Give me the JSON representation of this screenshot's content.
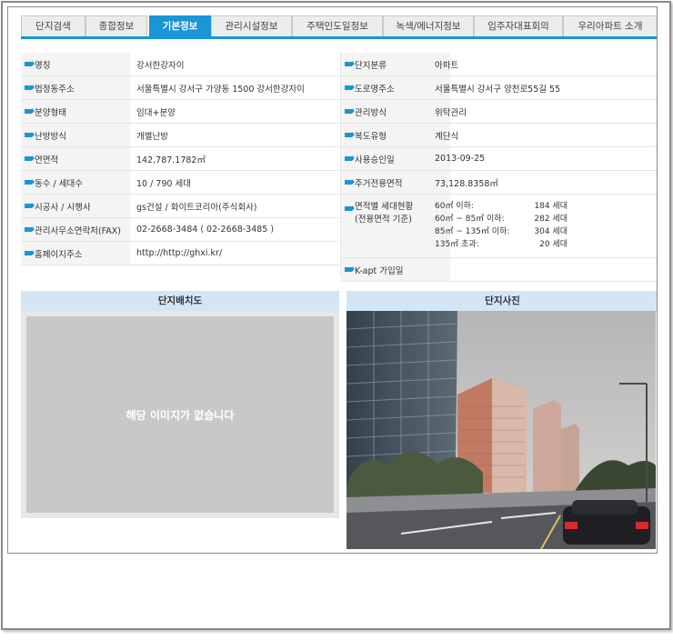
{
  "tabs": [
    {
      "label": "단지검색",
      "active": false
    },
    {
      "label": "종합정보",
      "active": false
    },
    {
      "label": "기본정보",
      "active": true
    },
    {
      "label": "관리시설정보",
      "active": false
    },
    {
      "label": "주택인도일정보",
      "active": false
    },
    {
      "label": "녹색/에너지정보",
      "active": false
    },
    {
      "label": "입주자대표회의",
      "active": false
    },
    {
      "label": "우리아파트 소개",
      "active": false
    }
  ],
  "left_rows": [
    {
      "label": "명칭",
      "value": "강서한강자이"
    },
    {
      "label": "법정동주소",
      "value": "서울특별시 강서구 가양동 1500 강서한강자이"
    },
    {
      "label": "분양형태",
      "value": "임대+분양"
    },
    {
      "label": "난방방식",
      "value": "개별난방"
    },
    {
      "label": "연면적",
      "value": "142,787.1782㎡"
    },
    {
      "label": "동수 / 세대수",
      "value": "10 / 790 세대"
    },
    {
      "label": "시공사 / 시행사",
      "value": "gs건설 / 화이트코리아(주식회사)"
    },
    {
      "label": "관리사무소연락처(FAX)",
      "value": "02-2668-3484 ( 02-2668-3485 )"
    },
    {
      "label": "홈페이지주소",
      "value": "http://http://ghxi.kr/"
    }
  ],
  "right_rows": [
    {
      "label": "단지분류",
      "value": "아파트"
    },
    {
      "label": "도로명주소",
      "value": "서울특별시 강서구 양천로55길 55"
    },
    {
      "label": "관리방식",
      "value": "위탁관리"
    },
    {
      "label": "복도유형",
      "value": "계단식"
    },
    {
      "label": "사용승인일",
      "value": "2013-09-25"
    },
    {
      "label": "주거전용면적",
      "value": "73,128.8358㎡"
    }
  ],
  "area_row": {
    "label_line1": "면적별 세대현황",
    "label_line2": "(전용면적 기준)",
    "items": [
      {
        "range": "60㎡ 이하:",
        "count": "184 세대"
      },
      {
        "range": "60㎡ ~ 85㎡ 이하:",
        "count": "282 세대"
      },
      {
        "range": "85㎡ ~ 135㎡ 이하:",
        "count": "304 세대"
      },
      {
        "range": "135㎡ 초과:",
        "count": "20 세대"
      }
    ]
  },
  "kapt_row": {
    "label": "K-apt 가입일",
    "value": ""
  },
  "sections": {
    "layout_title": "단지배치도",
    "photo_title": "단지사진",
    "no_image_text": "해당 이미지가 없습니다"
  },
  "colors": {
    "accent": "#1a95d6",
    "section_header": "#d3e6f6",
    "label_bg": "#f4f4f4"
  }
}
